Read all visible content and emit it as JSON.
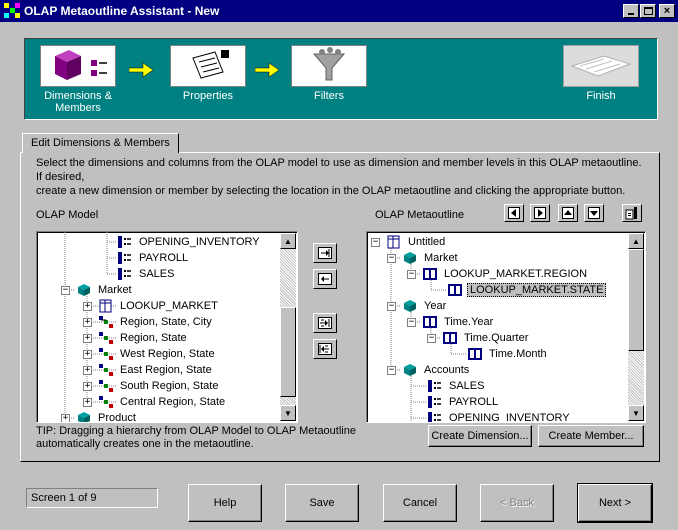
{
  "window": {
    "title": "OLAP Metaoutline Assistant - New"
  },
  "steps": [
    {
      "label": "Dimensions & Members"
    },
    {
      "label": "Properties"
    },
    {
      "label": "Filters"
    },
    {
      "label": "Finish"
    }
  ],
  "tab": {
    "label": "Edit Dimensions & Members"
  },
  "instructions": {
    "line1": "Select the dimensions and columns from the OLAP model to use as dimension and member levels in this OLAP metaoutline. If desired,",
    "line2": "create a new dimension or member by selecting the location in the OLAP metaoutline and clicking the appropriate button."
  },
  "olap_model": {
    "label": "OLAP Model",
    "items": [
      {
        "text": "OPENING_INVENTORY"
      },
      {
        "text": "PAYROLL"
      },
      {
        "text": "SALES"
      },
      {
        "text": "Market"
      },
      {
        "text": "LOOKUP_MARKET"
      },
      {
        "text": "Region, State, City"
      },
      {
        "text": "Region, State"
      },
      {
        "text": "West Region, State"
      },
      {
        "text": "East Region, State"
      },
      {
        "text": "South Region, State"
      },
      {
        "text": "Central Region, State"
      },
      {
        "text": "Product"
      }
    ]
  },
  "metaoutline": {
    "label": "OLAP Metaoutline",
    "items": [
      {
        "text": "Untitled"
      },
      {
        "text": "Market"
      },
      {
        "text": "LOOKUP_MARKET.REGION"
      },
      {
        "text": "LOOKUP_MARKET.STATE"
      },
      {
        "text": "Year"
      },
      {
        "text": "Time.Year"
      },
      {
        "text": "Time.Quarter"
      },
      {
        "text": "Time.Month"
      },
      {
        "text": "Accounts"
      },
      {
        "text": "SALES"
      },
      {
        "text": "PAYROLL"
      },
      {
        "text": "OPENING_INVENTORY"
      }
    ]
  },
  "tip": {
    "line1": "TIP: Dragging a hierarchy from OLAP Model to OLAP Metaoutline",
    "line2": "automatically creates one in the metaoutline."
  },
  "buttons": {
    "create_dimension": "Create Dimension...",
    "create_member": "Create Member...",
    "help": "Help",
    "save": "Save",
    "cancel": "Cancel",
    "back": "< Back",
    "next": "Next >"
  },
  "status": {
    "text": "Screen 1 of 9"
  },
  "icons": {
    "move_right": "arrow-right-into-icon",
    "move_left": "arrow-left-out-icon",
    "move_all_right": "arrow-right-all-icon",
    "move_all_left": "arrow-left-all-icon",
    "nav_left": "triangle-left-icon",
    "nav_right": "triangle-right-icon",
    "nav_up": "triangle-up-icon",
    "nav_down": "triangle-down-icon",
    "properties": "properties-icon"
  },
  "colors": {
    "titlebar": "#000080",
    "header_band": "#008080",
    "window": "#c0c0c0",
    "arrow": "#ffff00"
  }
}
